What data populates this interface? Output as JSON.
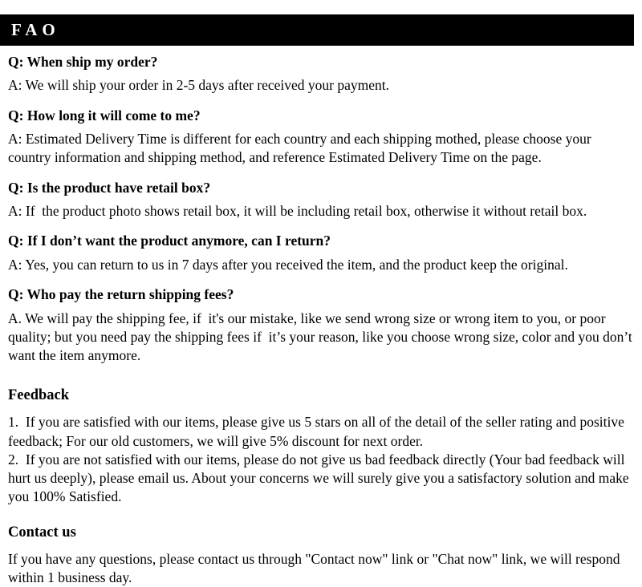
{
  "header": {
    "title": "FAO"
  },
  "faq": {
    "items": [
      {
        "question": "Q: When ship my order?",
        "answer": "A: We will ship your order in 2-5 days after received your payment."
      },
      {
        "question": "Q: How long it will come to me?",
        "answer": "A: Estimated Delivery Time is different for each country and each shipping mothed, please choose your country information and shipping method, and reference Estimated Delivery Time on the page."
      },
      {
        "question": "Q: Is the product have retail box?",
        "answer": "A: If  the product photo shows retail box, it will be including retail box, otherwise it without retail box."
      },
      {
        "question": "Q: If I don’t want the product anymore, can I return?",
        "answer": "A: Yes, you can return to us in 7 days after you received the item, and the product keep the original."
      },
      {
        "question": "Q: Who pay the return shipping fees?",
        "answer": "A. We will pay the shipping fee, if  it's our mistake, like we send wrong size or wrong item to you, or poor quality; but you need pay the shipping fees if  it’s your reason, like you choose wrong size, color and you don’t want the item anymore."
      }
    ]
  },
  "feedback": {
    "heading": "Feedback",
    "items": [
      "1.  If you are satisfied with our items, please give us 5 stars on all of the detail of the seller rating and positive feedback; For our old customers, we will give 5% discount for next order.",
      "2.  If you are not satisfied with our items, please do not give us bad feedback directly (Your bad feedback will hurt us deeply), please email us. About your concerns we will surely give you a satisfactory solution and make you 100% Satisfied."
    ]
  },
  "contact": {
    "heading": "Contact us",
    "text": "If you have any questions, please contact us through \"Contact now\" link or \"Chat now\" link, we will respond within 1 business day."
  },
  "colors": {
    "header_background": "#000000",
    "header_text": "#ffffff",
    "page_background": "#ffffff",
    "body_text": "#000000"
  }
}
